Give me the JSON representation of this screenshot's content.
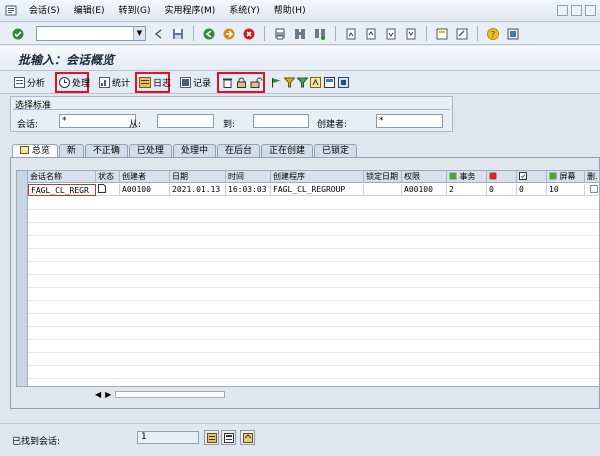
{
  "menu": [
    "会话(S)",
    "编辑(E)",
    "转到(G)",
    "实用程序(M)",
    "系统(Y)",
    "帮助(H)"
  ],
  "title": "批输入：会话概览",
  "toolbar2": {
    "analyze": "分析",
    "process": "处理",
    "statistics": "统计",
    "log": "日志",
    "record": "记录"
  },
  "selection": {
    "header": "选择标准",
    "session_label": "会话:",
    "session_value": "*",
    "from_label": "从:",
    "from_value": "",
    "to_label": "到:",
    "to_value": "",
    "creator_label": "创建者:",
    "creator_value": "*"
  },
  "tabs": [
    "总览",
    "新",
    "不正确",
    "已处理",
    "处理中",
    "在后台",
    "正在创建",
    "已锁定"
  ],
  "table": {
    "headers": [
      "会话名称",
      "状态",
      "创建者",
      "日期",
      "时间",
      "创建程序",
      "锁定日期",
      "权限",
      "事务",
      "",
      "",
      "屏幕",
      "删."
    ],
    "rows": [
      [
        "FAGL_CL_REGR",
        "",
        "A00100",
        "2021.01.13",
        "16:03:03",
        "FAGL_CL_REGROUP",
        "",
        "A00100",
        "2",
        "0",
        "0",
        "10",
        ""
      ]
    ]
  },
  "status": {
    "found_label": "已找到会话:",
    "found_count": "1"
  }
}
